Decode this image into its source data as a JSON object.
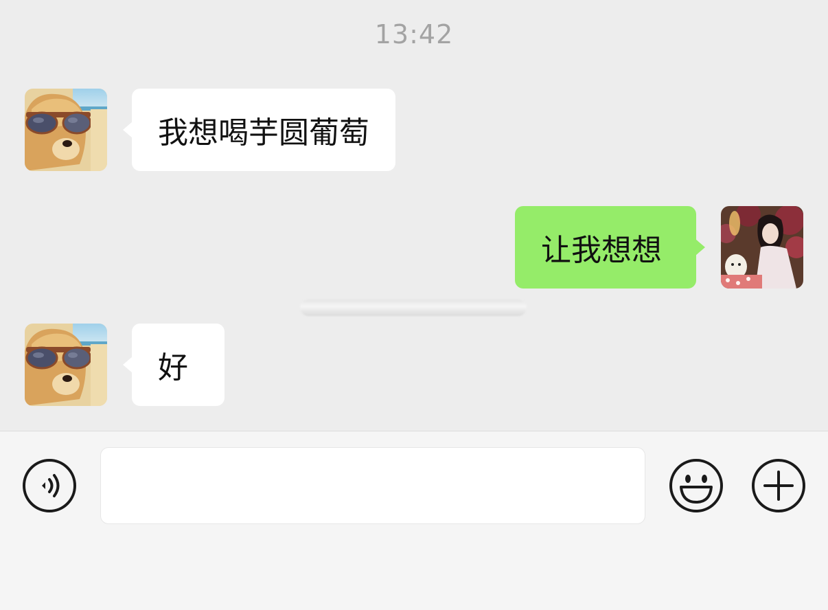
{
  "timestamp": "13:42",
  "messages": [
    {
      "side": "in",
      "text": "我想喝芋圆葡萄",
      "avatar": "dog-sunglasses-avatar"
    },
    {
      "side": "out",
      "text": "让我想想",
      "avatar": "woman-photo-avatar"
    },
    {
      "side": "in",
      "text": "好",
      "avatar": "dog-sunglasses-avatar"
    }
  ],
  "input": {
    "value": "",
    "placeholder": ""
  },
  "icons": {
    "voice": "voice-icon",
    "emoji": "emoji-icon",
    "plus": "plus-icon"
  },
  "colors": {
    "chat_bg": "#ededed",
    "incoming_bubble": "#ffffff",
    "outgoing_bubble": "#95ec69",
    "input_bar_bg": "#f5f5f5",
    "timestamp": "#a3a3a3"
  }
}
